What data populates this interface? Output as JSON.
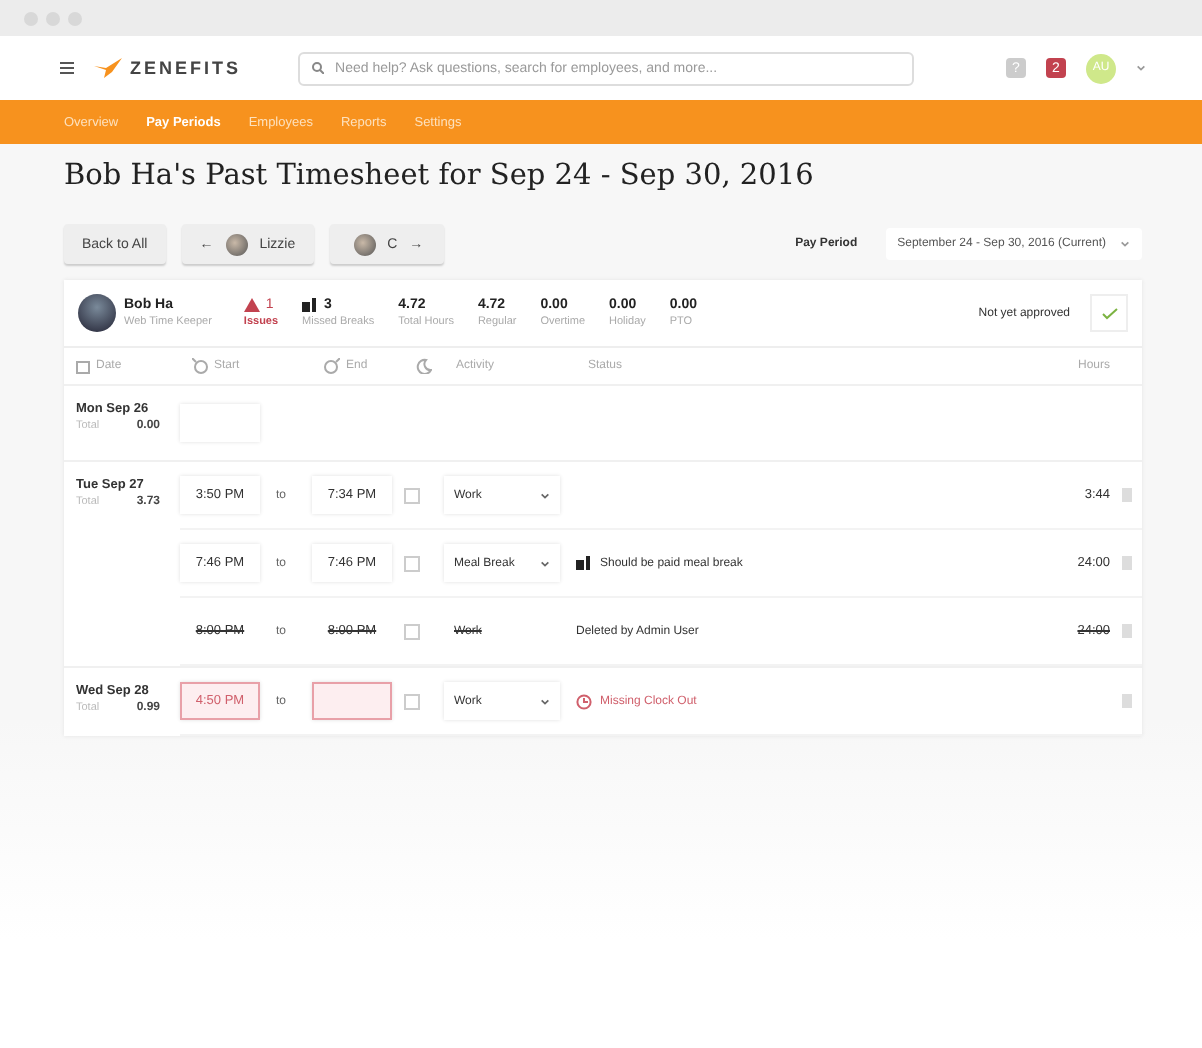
{
  "header": {
    "logo": "ZENEFITS",
    "search": {
      "placeholder": "Need help? Ask questions, search for employees, and more..."
    },
    "help": "?",
    "notifications": "2",
    "avatar": "AU"
  },
  "nav": [
    {
      "label": "Overview",
      "selected": false
    },
    {
      "label": "Pay Periods",
      "selected": true
    },
    {
      "label": "Employees",
      "selected": false
    },
    {
      "label": "Reports",
      "selected": false
    },
    {
      "label": "Settings",
      "selected": false
    }
  ],
  "title": "Bob Ha's Past Timesheet for Sep 24 - Sep 30, 2016",
  "actions": {
    "back": "Back to All",
    "prev_arrow": "←",
    "prev": "Lizzie",
    "next": "C",
    "next_arrow": "→"
  },
  "pay_period": {
    "label": "Pay Period",
    "value": "September 24 - Sep 30, 2016 (Current)"
  },
  "employee": {
    "name": "Bob Ha",
    "role": "Web Time Keeper",
    "approval": "Not yet approved",
    "stats": [
      {
        "kind": "issues",
        "value": "1",
        "label": "Issues"
      },
      {
        "kind": "breaks",
        "value": "3",
        "label": "Missed Breaks"
      },
      {
        "kind": "plain",
        "value": "4.72",
        "label": "Total Hours"
      },
      {
        "kind": "plain",
        "value": "4.72",
        "label": "Regular"
      },
      {
        "kind": "plain",
        "value": "0.00",
        "label": "Overtime"
      },
      {
        "kind": "plain",
        "value": "0.00",
        "label": "Holiday"
      },
      {
        "kind": "plain",
        "value": "0.00",
        "label": "PTO"
      }
    ]
  },
  "columns": {
    "date": "Date",
    "start": "Start",
    "end": "End",
    "activity": "Activity",
    "status": "Status",
    "hours": "Hours"
  },
  "days": [
    {
      "kind": "empty",
      "date": "Mon Sep 26",
      "total_label": "Total",
      "total": "0.00"
    },
    {
      "kind": "entries",
      "date": "Tue Sep 27",
      "total_label": "Total",
      "total": "3.73",
      "entries": [
        {
          "kind": "normal",
          "start": "3:50 PM",
          "to": "to",
          "end": "7:34 PM",
          "checked": false,
          "activity": "Work",
          "hours": "3:44"
        },
        {
          "kind": "normal",
          "start": "7:46 PM",
          "to": "to",
          "end": "7:46 PM",
          "checked": false,
          "activity": "Meal Break",
          "status": {
            "kind": "break",
            "text": "Should be paid meal break"
          },
          "hours": "24:00"
        },
        {
          "kind": "deleted",
          "start": "8:00 PM",
          "to": "to",
          "end": "8:00 PM",
          "checked": false,
          "activity": "Work",
          "status": {
            "kind": "plain",
            "text": "Deleted by Admin User"
          },
          "hours": "24:00"
        }
      ]
    },
    {
      "kind": "entries",
      "date": "Wed Sep 28",
      "total_label": "Total",
      "total": "0.99",
      "entries": [
        {
          "kind": "missing",
          "start": "4:50 PM",
          "to": "to",
          "checked": false,
          "activity": "Work",
          "status": {
            "kind": "clock",
            "text": "Missing Clock Out"
          }
        }
      ]
    }
  ]
}
